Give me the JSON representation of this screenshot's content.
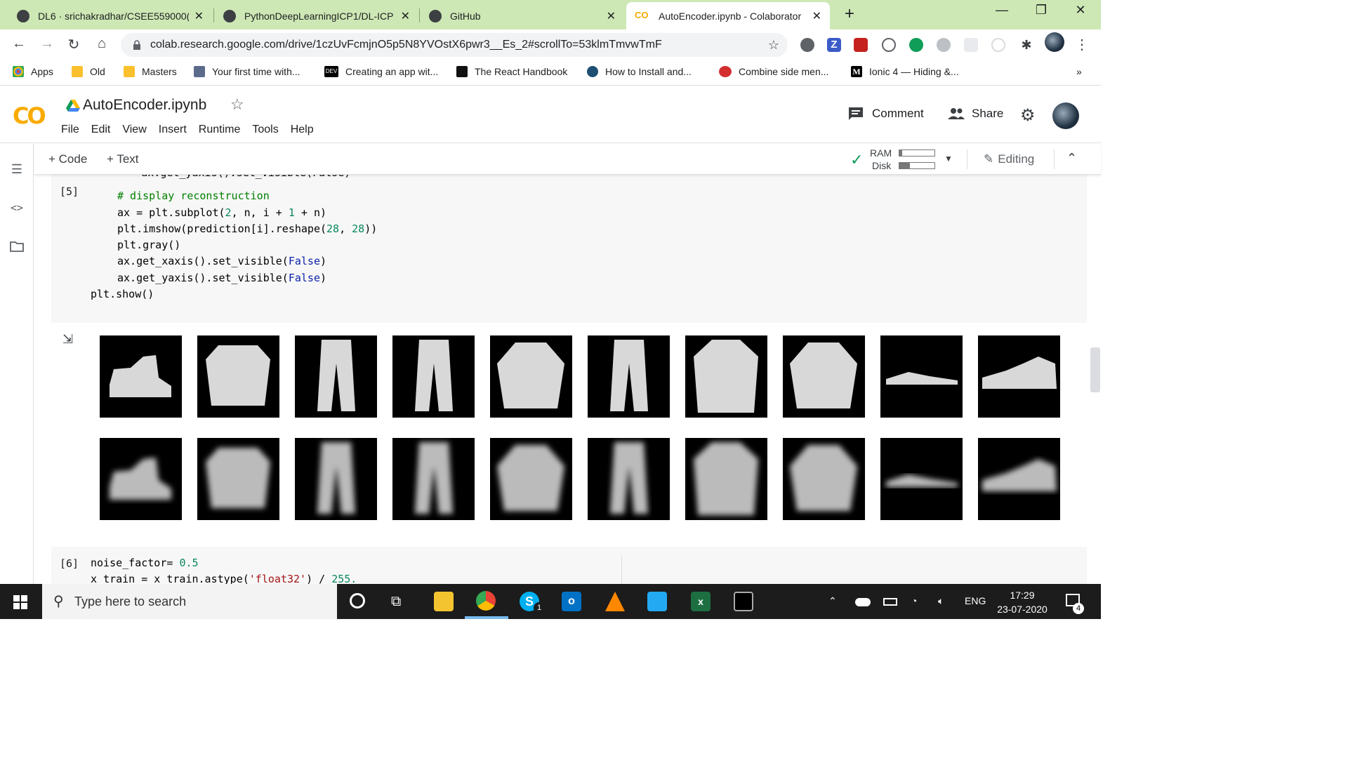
{
  "browser": {
    "tabs": [
      {
        "title": "DL6 · srichakradhar/CSEE559000(",
        "active": false
      },
      {
        "title": "PythonDeepLearningICP1/DL-ICP",
        "active": false
      },
      {
        "title": "GitHub",
        "active": false
      },
      {
        "title": "AutoEncoder.ipynb - Colaborator",
        "active": true
      }
    ],
    "new_tab": "+",
    "url": "colab.research.google.com/drive/1czUvFcmjnO5p5N8YVOstX6pwr3__Es_2#scrollTo=53klmTmvwTmF",
    "bookmarks": [
      {
        "label": "Apps"
      },
      {
        "label": "Old"
      },
      {
        "label": "Masters"
      },
      {
        "label": "Your first time with..."
      },
      {
        "label": "Creating an app wit..."
      },
      {
        "label": "The React Handbook"
      },
      {
        "label": "How to Install and..."
      },
      {
        "label": "Combine side men..."
      },
      {
        "label": "Ionic 4 — Hiding &..."
      }
    ],
    "bookmarks_more": "»"
  },
  "colab": {
    "logo": "CO",
    "notebook_name": "AutoEncoder.ipynb",
    "menu": [
      "File",
      "Edit",
      "View",
      "Insert",
      "Runtime",
      "Tools",
      "Help"
    ],
    "comment_label": "Comment",
    "share_label": "Share",
    "add_code_label": "Code",
    "add_text_label": "Text",
    "ram_label": "RAM",
    "disk_label": "Disk",
    "ram_fraction": 0.08,
    "disk_fraction": 0.3,
    "editing_label": "Editing"
  },
  "cells": {
    "cell5": {
      "exec_count": "[5]",
      "partial_line": "        ax.get_yaxis().set_visible(False)",
      "comment": "# display reconstruction",
      "line_subplot_a": "ax = plt.subplot(",
      "line_subplot_2": "2",
      "line_subplot_b": ", n, i + ",
      "line_subplot_1": "1",
      "line_subplot_c": " + n)",
      "line_imshow_a": "plt.imshow(prediction[i].reshape(",
      "line_imshow_28a": "28",
      "line_imshow_sep": ", ",
      "line_imshow_28b": "28",
      "line_imshow_c": "))",
      "line_gray": "plt.gray()",
      "line_xaxis_a": "ax.get_xaxis().set_visible(",
      "line_yaxis_a": "ax.get_yaxis().set_visible(",
      "false_kw": "False",
      "close_paren": ")",
      "line_show": "plt.show()"
    },
    "cell6": {
      "exec_count": "[6]",
      "line1_a": "noise_factor= ",
      "line1_val": "0.5",
      "line2_a": "x_train = x_train.astype(",
      "line2_str": "'float32'",
      "line2_b": ") / ",
      "line2_val": "255."
    }
  },
  "output_images": {
    "originals": [
      "ankle-boot",
      "pullover",
      "trouser",
      "trouser",
      "shirt",
      "trouser",
      "coat",
      "shirt",
      "sandal",
      "sneaker"
    ],
    "reconstructions": [
      "ankle-boot",
      "pullover",
      "trouser",
      "trouser",
      "shirt",
      "trouser",
      "coat",
      "shirt",
      "sandal",
      "sneaker"
    ]
  },
  "taskbar": {
    "search_placeholder": "Type here to search",
    "language": "ENG",
    "time": "17:29",
    "date": "23-07-2020",
    "notification_count": "4",
    "skype_badge": "1"
  }
}
